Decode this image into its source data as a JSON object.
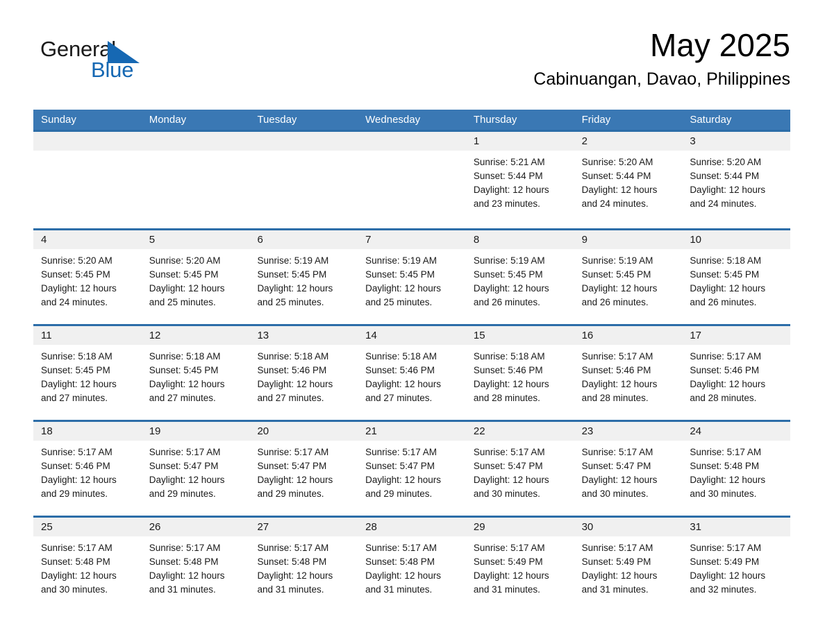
{
  "brand": {
    "name_part1": "General",
    "name_part2": "Blue",
    "accent_color": "#1668b3",
    "triangle_icon": "triangle-icon"
  },
  "header": {
    "month_title": "May 2025",
    "location": "Cabinuangan, Davao, Philippines"
  },
  "theme": {
    "header_blue": "#3a78b4",
    "row_rule_blue": "#2c6da8",
    "daynum_band": "#f0f0f0",
    "page_background": "#ffffff"
  },
  "calendar": {
    "weekdays": [
      "Sunday",
      "Monday",
      "Tuesday",
      "Wednesday",
      "Thursday",
      "Friday",
      "Saturday"
    ],
    "weeks": [
      {
        "days": [
          {
            "num": "",
            "sunrise": "",
            "sunset": "",
            "daylight_l1": "",
            "daylight_l2": ""
          },
          {
            "num": "",
            "sunrise": "",
            "sunset": "",
            "daylight_l1": "",
            "daylight_l2": ""
          },
          {
            "num": "",
            "sunrise": "",
            "sunset": "",
            "daylight_l1": "",
            "daylight_l2": ""
          },
          {
            "num": "",
            "sunrise": "",
            "sunset": "",
            "daylight_l1": "",
            "daylight_l2": ""
          },
          {
            "num": "1",
            "sunrise": "Sunrise: 5:21 AM",
            "sunset": "Sunset: 5:44 PM",
            "daylight_l1": "Daylight: 12 hours",
            "daylight_l2": "and 23 minutes."
          },
          {
            "num": "2",
            "sunrise": "Sunrise: 5:20 AM",
            "sunset": "Sunset: 5:44 PM",
            "daylight_l1": "Daylight: 12 hours",
            "daylight_l2": "and 24 minutes."
          },
          {
            "num": "3",
            "sunrise": "Sunrise: 5:20 AM",
            "sunset": "Sunset: 5:44 PM",
            "daylight_l1": "Daylight: 12 hours",
            "daylight_l2": "and 24 minutes."
          }
        ]
      },
      {
        "days": [
          {
            "num": "4",
            "sunrise": "Sunrise: 5:20 AM",
            "sunset": "Sunset: 5:45 PM",
            "daylight_l1": "Daylight: 12 hours",
            "daylight_l2": "and 24 minutes."
          },
          {
            "num": "5",
            "sunrise": "Sunrise: 5:20 AM",
            "sunset": "Sunset: 5:45 PM",
            "daylight_l1": "Daylight: 12 hours",
            "daylight_l2": "and 25 minutes."
          },
          {
            "num": "6",
            "sunrise": "Sunrise: 5:19 AM",
            "sunset": "Sunset: 5:45 PM",
            "daylight_l1": "Daylight: 12 hours",
            "daylight_l2": "and 25 minutes."
          },
          {
            "num": "7",
            "sunrise": "Sunrise: 5:19 AM",
            "sunset": "Sunset: 5:45 PM",
            "daylight_l1": "Daylight: 12 hours",
            "daylight_l2": "and 25 minutes."
          },
          {
            "num": "8",
            "sunrise": "Sunrise: 5:19 AM",
            "sunset": "Sunset: 5:45 PM",
            "daylight_l1": "Daylight: 12 hours",
            "daylight_l2": "and 26 minutes."
          },
          {
            "num": "9",
            "sunrise": "Sunrise: 5:19 AM",
            "sunset": "Sunset: 5:45 PM",
            "daylight_l1": "Daylight: 12 hours",
            "daylight_l2": "and 26 minutes."
          },
          {
            "num": "10",
            "sunrise": "Sunrise: 5:18 AM",
            "sunset": "Sunset: 5:45 PM",
            "daylight_l1": "Daylight: 12 hours",
            "daylight_l2": "and 26 minutes."
          }
        ]
      },
      {
        "days": [
          {
            "num": "11",
            "sunrise": "Sunrise: 5:18 AM",
            "sunset": "Sunset: 5:45 PM",
            "daylight_l1": "Daylight: 12 hours",
            "daylight_l2": "and 27 minutes."
          },
          {
            "num": "12",
            "sunrise": "Sunrise: 5:18 AM",
            "sunset": "Sunset: 5:45 PM",
            "daylight_l1": "Daylight: 12 hours",
            "daylight_l2": "and 27 minutes."
          },
          {
            "num": "13",
            "sunrise": "Sunrise: 5:18 AM",
            "sunset": "Sunset: 5:46 PM",
            "daylight_l1": "Daylight: 12 hours",
            "daylight_l2": "and 27 minutes."
          },
          {
            "num": "14",
            "sunrise": "Sunrise: 5:18 AM",
            "sunset": "Sunset: 5:46 PM",
            "daylight_l1": "Daylight: 12 hours",
            "daylight_l2": "and 27 minutes."
          },
          {
            "num": "15",
            "sunrise": "Sunrise: 5:18 AM",
            "sunset": "Sunset: 5:46 PM",
            "daylight_l1": "Daylight: 12 hours",
            "daylight_l2": "and 28 minutes."
          },
          {
            "num": "16",
            "sunrise": "Sunrise: 5:17 AM",
            "sunset": "Sunset: 5:46 PM",
            "daylight_l1": "Daylight: 12 hours",
            "daylight_l2": "and 28 minutes."
          },
          {
            "num": "17",
            "sunrise": "Sunrise: 5:17 AM",
            "sunset": "Sunset: 5:46 PM",
            "daylight_l1": "Daylight: 12 hours",
            "daylight_l2": "and 28 minutes."
          }
        ]
      },
      {
        "days": [
          {
            "num": "18",
            "sunrise": "Sunrise: 5:17 AM",
            "sunset": "Sunset: 5:46 PM",
            "daylight_l1": "Daylight: 12 hours",
            "daylight_l2": "and 29 minutes."
          },
          {
            "num": "19",
            "sunrise": "Sunrise: 5:17 AM",
            "sunset": "Sunset: 5:47 PM",
            "daylight_l1": "Daylight: 12 hours",
            "daylight_l2": "and 29 minutes."
          },
          {
            "num": "20",
            "sunrise": "Sunrise: 5:17 AM",
            "sunset": "Sunset: 5:47 PM",
            "daylight_l1": "Daylight: 12 hours",
            "daylight_l2": "and 29 minutes."
          },
          {
            "num": "21",
            "sunrise": "Sunrise: 5:17 AM",
            "sunset": "Sunset: 5:47 PM",
            "daylight_l1": "Daylight: 12 hours",
            "daylight_l2": "and 29 minutes."
          },
          {
            "num": "22",
            "sunrise": "Sunrise: 5:17 AM",
            "sunset": "Sunset: 5:47 PM",
            "daylight_l1": "Daylight: 12 hours",
            "daylight_l2": "and 30 minutes."
          },
          {
            "num": "23",
            "sunrise": "Sunrise: 5:17 AM",
            "sunset": "Sunset: 5:47 PM",
            "daylight_l1": "Daylight: 12 hours",
            "daylight_l2": "and 30 minutes."
          },
          {
            "num": "24",
            "sunrise": "Sunrise: 5:17 AM",
            "sunset": "Sunset: 5:48 PM",
            "daylight_l1": "Daylight: 12 hours",
            "daylight_l2": "and 30 minutes."
          }
        ]
      },
      {
        "days": [
          {
            "num": "25",
            "sunrise": "Sunrise: 5:17 AM",
            "sunset": "Sunset: 5:48 PM",
            "daylight_l1": "Daylight: 12 hours",
            "daylight_l2": "and 30 minutes."
          },
          {
            "num": "26",
            "sunrise": "Sunrise: 5:17 AM",
            "sunset": "Sunset: 5:48 PM",
            "daylight_l1": "Daylight: 12 hours",
            "daylight_l2": "and 31 minutes."
          },
          {
            "num": "27",
            "sunrise": "Sunrise: 5:17 AM",
            "sunset": "Sunset: 5:48 PM",
            "daylight_l1": "Daylight: 12 hours",
            "daylight_l2": "and 31 minutes."
          },
          {
            "num": "28",
            "sunrise": "Sunrise: 5:17 AM",
            "sunset": "Sunset: 5:48 PM",
            "daylight_l1": "Daylight: 12 hours",
            "daylight_l2": "and 31 minutes."
          },
          {
            "num": "29",
            "sunrise": "Sunrise: 5:17 AM",
            "sunset": "Sunset: 5:49 PM",
            "daylight_l1": "Daylight: 12 hours",
            "daylight_l2": "and 31 minutes."
          },
          {
            "num": "30",
            "sunrise": "Sunrise: 5:17 AM",
            "sunset": "Sunset: 5:49 PM",
            "daylight_l1": "Daylight: 12 hours",
            "daylight_l2": "and 31 minutes."
          },
          {
            "num": "31",
            "sunrise": "Sunrise: 5:17 AM",
            "sunset": "Sunset: 5:49 PM",
            "daylight_l1": "Daylight: 12 hours",
            "daylight_l2": "and 32 minutes."
          }
        ]
      }
    ]
  }
}
